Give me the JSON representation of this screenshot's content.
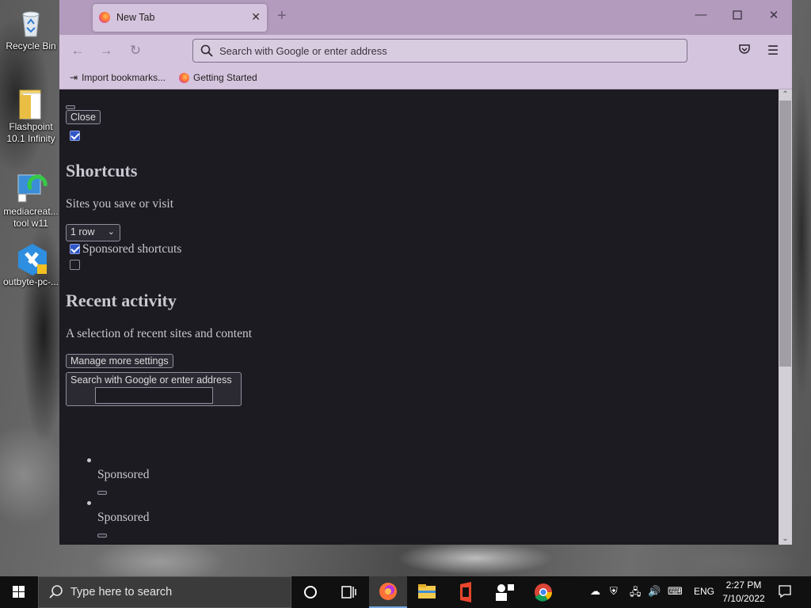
{
  "desktop": {
    "icons": [
      {
        "label": "Recycle Bin"
      },
      {
        "label": "Flashpoint 10.1 Infinity"
      },
      {
        "label": "mediacreat... tool w11"
      },
      {
        "label": "outbyte-pc-..."
      }
    ]
  },
  "browser": {
    "tab": {
      "title": "New Tab"
    },
    "url_bar": {
      "placeholder": "Search with Google or enter address"
    },
    "bookmarks": [
      {
        "label": "Import bookmarks..."
      },
      {
        "label": "Getting Started"
      }
    ]
  },
  "page": {
    "close_label": "Close",
    "shortcuts": {
      "heading": "Shortcuts",
      "description": "Sites you save or visit",
      "rows_select": "1 row",
      "sponsored_label": "Sponsored shortcuts",
      "sponsored_checked": true
    },
    "recent": {
      "heading": "Recent activity",
      "description": "A selection of recent sites and content"
    },
    "manage_label": "Manage more settings",
    "search_label": "Search with Google or enter address",
    "list_items": [
      {
        "label": "Sponsored"
      },
      {
        "label": "Sponsored"
      }
    ]
  },
  "taskbar": {
    "search_placeholder": "Type here to search",
    "language": "ENG",
    "time": "2:27 PM",
    "date": "7/10/2022"
  },
  "colors": {
    "browser_frame": "#b39bbe",
    "toolbar": "#d5c4dd",
    "page_bg": "#1c1b22",
    "checkbox_accent": "#2f56c8"
  }
}
